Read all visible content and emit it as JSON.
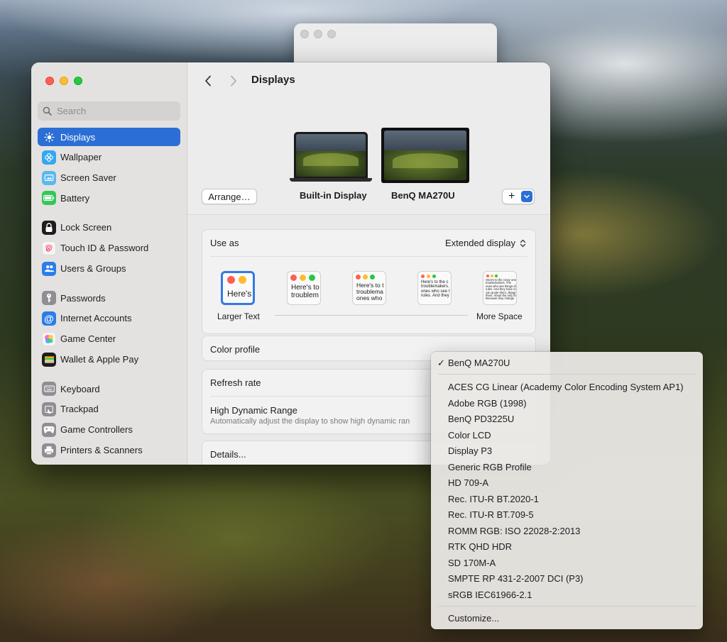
{
  "sidebar": {
    "search_placeholder": "Search",
    "items": [
      {
        "label": "Displays",
        "icon": "sun-icon",
        "color": "#2b6fd6"
      },
      {
        "label": "Wallpaper",
        "icon": "flower-icon",
        "color": "#35a7f0"
      },
      {
        "label": "Screen Saver",
        "icon": "screen-saver-icon",
        "color": "#5bb8f1"
      },
      {
        "label": "Battery",
        "icon": "battery-icon",
        "color": "#35c759"
      },
      {
        "label": "Lock Screen",
        "icon": "lock-icon",
        "color": "#1d1d1f"
      },
      {
        "label": "Touch ID & Password",
        "icon": "fingerprint-icon",
        "color": "#f5f5f5"
      },
      {
        "label": "Users & Groups",
        "icon": "users-icon",
        "color": "#2b7de9"
      },
      {
        "label": "Passwords",
        "icon": "key-icon",
        "color": "#8e8e93"
      },
      {
        "label": "Internet Accounts",
        "icon": "at-icon",
        "color": "#2b7de9"
      },
      {
        "label": "Game Center",
        "icon": "game-center-icon",
        "color": "#f5f5f5"
      },
      {
        "label": "Wallet & Apple Pay",
        "icon": "wallet-icon",
        "color": "#1d1d1f"
      },
      {
        "label": "Keyboard",
        "icon": "keyboard-icon",
        "color": "#8e8e93"
      },
      {
        "label": "Trackpad",
        "icon": "trackpad-icon",
        "color": "#8e8e93"
      },
      {
        "label": "Game Controllers",
        "icon": "gamepad-icon",
        "color": "#8e8e93"
      },
      {
        "label": "Printers & Scanners",
        "icon": "printer-icon",
        "color": "#8e8e93"
      }
    ]
  },
  "header": {
    "title": "Displays"
  },
  "arrangement": {
    "arrange_label": "Arrange…",
    "add_label": "+",
    "displays": [
      {
        "name": "Built-in Display"
      },
      {
        "name": "BenQ MA270U"
      }
    ]
  },
  "use_as": {
    "label": "Use as",
    "value": "Extended display",
    "scale_left_label": "Larger Text",
    "scale_right_label": "More Space",
    "scale_samples": [
      "Here's",
      "Here's to\ntroublem",
      "Here's to t\ntroublema\nones who",
      "Here's to the c\ntroublemakers.\nones who see t\nrules. And they",
      "Here's to the crazy one\ntroublemakers. The\nones who see things di\nrules. And they have no\ncan quote them, disagr\nthem. About the only th\nBecause they change"
    ]
  },
  "color_profile": {
    "label": "Color profile"
  },
  "refresh_rate": {
    "label": "Refresh rate"
  },
  "hdr": {
    "label": "High Dynamic Range",
    "description": "Automatically adjust the display to show high dynamic ran"
  },
  "details": {
    "label": "Details..."
  },
  "menu": {
    "selected": "BenQ MA270U",
    "options": [
      "ACES CG Linear (Academy Color Encoding System AP1)",
      "Adobe RGB (1998)",
      "BenQ PD3225U",
      "Color LCD",
      "Display P3",
      "Generic RGB Profile",
      "HD 709-A",
      "Rec. ITU-R BT.2020-1",
      "Rec. ITU-R BT.709-5",
      "ROMM RGB: ISO 22028-2:2013",
      "RTK QHD HDR",
      "SD 170M-A",
      "SMPTE RP 431-2-2007 DCI (P3)",
      "sRGB IEC61966-2.1"
    ],
    "customize": "Customize..."
  },
  "colors": {
    "accent": "#2b6fd6",
    "selection_ring": "#3479e3"
  }
}
